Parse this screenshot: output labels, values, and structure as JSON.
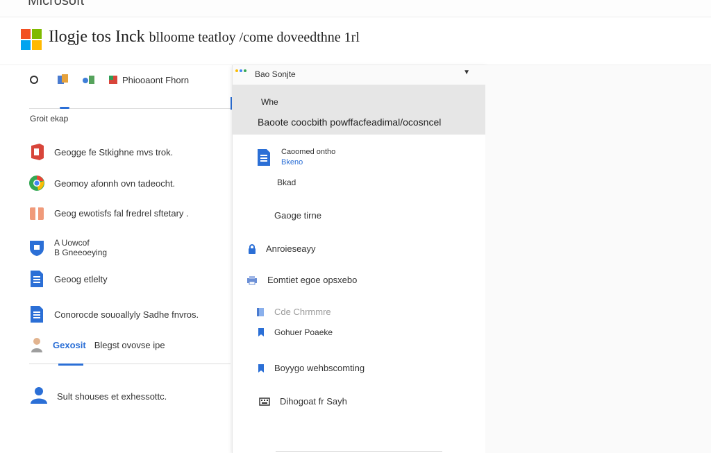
{
  "app": {
    "brand": "Microsoft",
    "title_main": "Ilogje tos Inck",
    "title_sub": "blloome teatloy /come doveedthne 1rl"
  },
  "colors": {
    "ms_red": "#f25022",
    "ms_green": "#7fba00",
    "ms_blue": "#00a4ef",
    "ms_yellow": "#ffb900",
    "accent_blue": "#2b6fd6"
  },
  "toolbar": {
    "items": [
      {
        "icon": "circle-icon"
      },
      {
        "icon": "files-icon"
      },
      {
        "icon": "apps-icon"
      },
      {
        "icon": "document-icon",
        "label": "Phiooaont Fhorn"
      }
    ]
  },
  "left_list": {
    "section_label": "Groit ekap",
    "items": [
      {
        "icon": "office-icon",
        "label": "Geogge fe Stkighne mvs trok."
      },
      {
        "icon": "chrome-icon",
        "label": "Geomoy afonnh ovn tadeocht."
      },
      {
        "icon": "gift-icon",
        "label": "Geog ewotisfs fal fredrel sftetary ."
      },
      {
        "icon": "shield-icon",
        "label_line1": "A Uowcof",
        "label_line2": "B Gneeoeying"
      },
      {
        "icon": "doc-blue-icon",
        "label": "Geoog etlelty"
      },
      {
        "icon": "doc-blue-icon",
        "label": "Conorocde souoallyly Sadhe fnvros."
      },
      {
        "icon": "person-icon",
        "chip": "Gexosit",
        "label": "Blegst ovovse ipe"
      }
    ],
    "footer": {
      "icon": "user-icon",
      "label": "Sult shouses et exhessottc."
    }
  },
  "dropdown": {
    "selected": "Bao Sonjte",
    "highlight_top": "Whe",
    "highlight_main": "Baoote coocbith powffacfeadimal/ocosncel",
    "items": [
      {
        "icon": "doc-blue-icon",
        "label_line1": "Caoomed ontho",
        "label_line2": "Bkeno"
      },
      {
        "label": "Bkad"
      },
      {
        "label": "Gaoge tirne"
      },
      {
        "icon": "lock-icon",
        "label": "Anroieseayy"
      },
      {
        "icon": "print-icon",
        "label": "Eomtiet egoe opsxebo"
      },
      {
        "icon": "book-icon",
        "label": "Cde Chrmmre",
        "muted": true
      },
      {
        "icon": "bookmark-icon",
        "label": "Gohuer Poaeke"
      },
      {
        "icon": "bookmark-icon",
        "label": "Boyygo wehbscomting"
      },
      {
        "icon": "keyboard-icon",
        "label": "Dihogoat fr Sayh"
      }
    ]
  }
}
